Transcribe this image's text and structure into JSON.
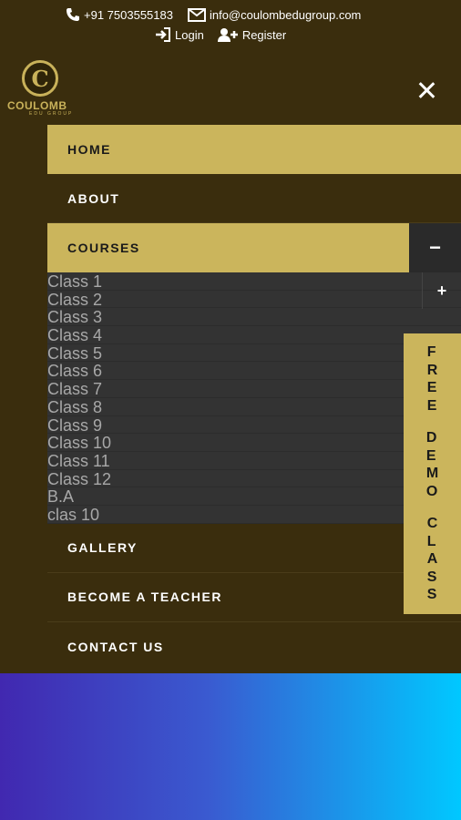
{
  "contact": {
    "phone": "+91 7503555183",
    "email": "info@coulombedugroup.com",
    "login_label": "Login",
    "register_label": "Register"
  },
  "logo": {
    "text": "COULOMB",
    "sub": "EDU GROUP",
    "mark": "C"
  },
  "menu": {
    "home": "HOME",
    "about": "ABOUT",
    "courses": "COURSES",
    "courses_toggle": "−",
    "gallery": "GALLERY",
    "become_teacher": "BECOME A TEACHER",
    "contact_us": "CONTACT US"
  },
  "courses_sub": {
    "expand": "+",
    "items": [
      "Class 1",
      "Class 2",
      "Class 3",
      "Class 4",
      "Class 5",
      "Class 6",
      "Class 7",
      "Class 8",
      "Class 9",
      "Class 10",
      "Class 11",
      "Class 12",
      "B.A",
      "clas 10"
    ]
  },
  "demo_tab": {
    "word1": "FREE",
    "word2": "DEMO",
    "word3": "CLASS"
  },
  "colors": {
    "background": "#3a2d0d",
    "accent": "#cbb55c",
    "submenu": "#333333"
  },
  "icons": {
    "phone": "phone-icon",
    "email": "envelope-icon",
    "login": "login-icon",
    "register": "user-plus-icon",
    "close": "close-icon"
  }
}
